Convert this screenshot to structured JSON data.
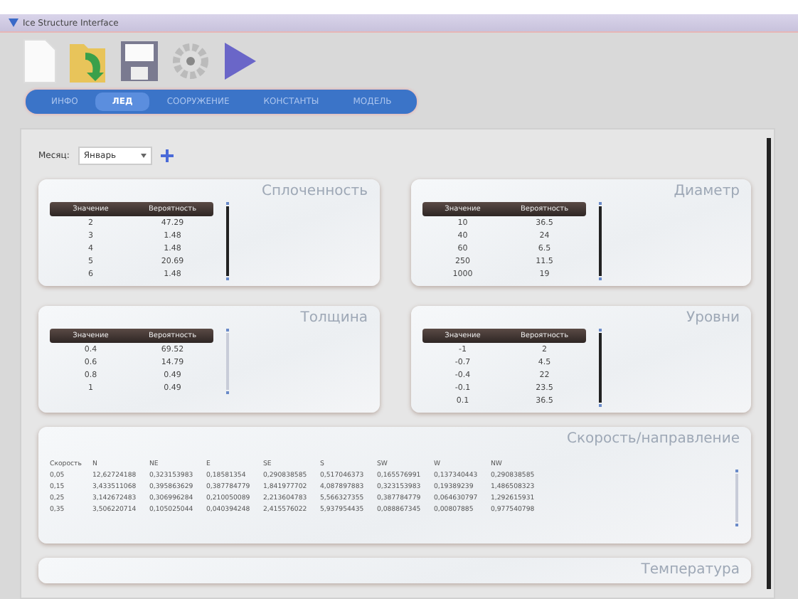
{
  "window": {
    "title": "Ice Structure Interface"
  },
  "tabs": [
    {
      "label": "ИНФО",
      "selected": false
    },
    {
      "label": "ЛЕД",
      "selected": true
    },
    {
      "label": "СООРУЖЕНИЕ",
      "selected": false
    },
    {
      "label": "КОНСТАНТЫ",
      "selected": false
    },
    {
      "label": "МОДЕЛЬ",
      "selected": false
    }
  ],
  "month": {
    "label": "Месяц:",
    "value": "Январь"
  },
  "panels": [
    {
      "title": "Сплоченность",
      "columns": [
        "Значение",
        "Вероятность"
      ],
      "rows": [
        [
          "2",
          "47.29"
        ],
        [
          "3",
          "1.48"
        ],
        [
          "4",
          "1.48"
        ],
        [
          "5",
          "20.69"
        ],
        [
          "6",
          "1.48"
        ]
      ]
    },
    {
      "title": "Диаметр",
      "columns": [
        "Значение",
        "Вероятность"
      ],
      "rows": [
        [
          "10",
          "36.5"
        ],
        [
          "40",
          "24"
        ],
        [
          "60",
          "6.5"
        ],
        [
          "250",
          "11.5"
        ],
        [
          "1000",
          "19"
        ]
      ]
    },
    {
      "title": "Толщина",
      "columns": [
        "Значение",
        "Вероятность"
      ],
      "rows": [
        [
          "0.4",
          "69.52"
        ],
        [
          "0.6",
          "14.79"
        ],
        [
          "0.8",
          "0.49"
        ],
        [
          "1",
          "0.49"
        ]
      ]
    },
    {
      "title": "Уровни",
      "columns": [
        "Значение",
        "Вероятность"
      ],
      "rows": [
        [
          "-1",
          "2"
        ],
        [
          "-0.7",
          "4.5"
        ],
        [
          "-0.4",
          "22"
        ],
        [
          "-0.1",
          "23.5"
        ],
        [
          "0.1",
          "36.5"
        ]
      ]
    }
  ],
  "speed": {
    "title": "Скорость/направление",
    "columns": [
      "Скорость",
      "N",
      "NE",
      "E",
      "SE",
      "S",
      "SW",
      "W",
      "NW"
    ],
    "rows": [
      [
        "0,05",
        "12,62724188",
        "0,323153983",
        "0,18581354",
        "0,290838585",
        "0,517046373",
        "0,165576991",
        "0,137340443",
        "0,290838585"
      ],
      [
        "0,15",
        "3,433511068",
        "0,395863629",
        "0,387784779",
        "1,841977702",
        "4,087897883",
        "0,323153983",
        "0,19389239",
        "1,486508323"
      ],
      [
        "0,25",
        "3,142672483",
        "0,306996284",
        "0,210050089",
        "2,213604783",
        "5,566327355",
        "0,387784779",
        "0,064630797",
        "1,292615931"
      ],
      [
        "0,35",
        "3,506220714",
        "0,105025044",
        "0,040394248",
        "2,415576022",
        "5,937954435",
        "0,088867345",
        "0,00807885",
        "0,977540798"
      ]
    ]
  },
  "next_panel": {
    "title": "Температура"
  }
}
